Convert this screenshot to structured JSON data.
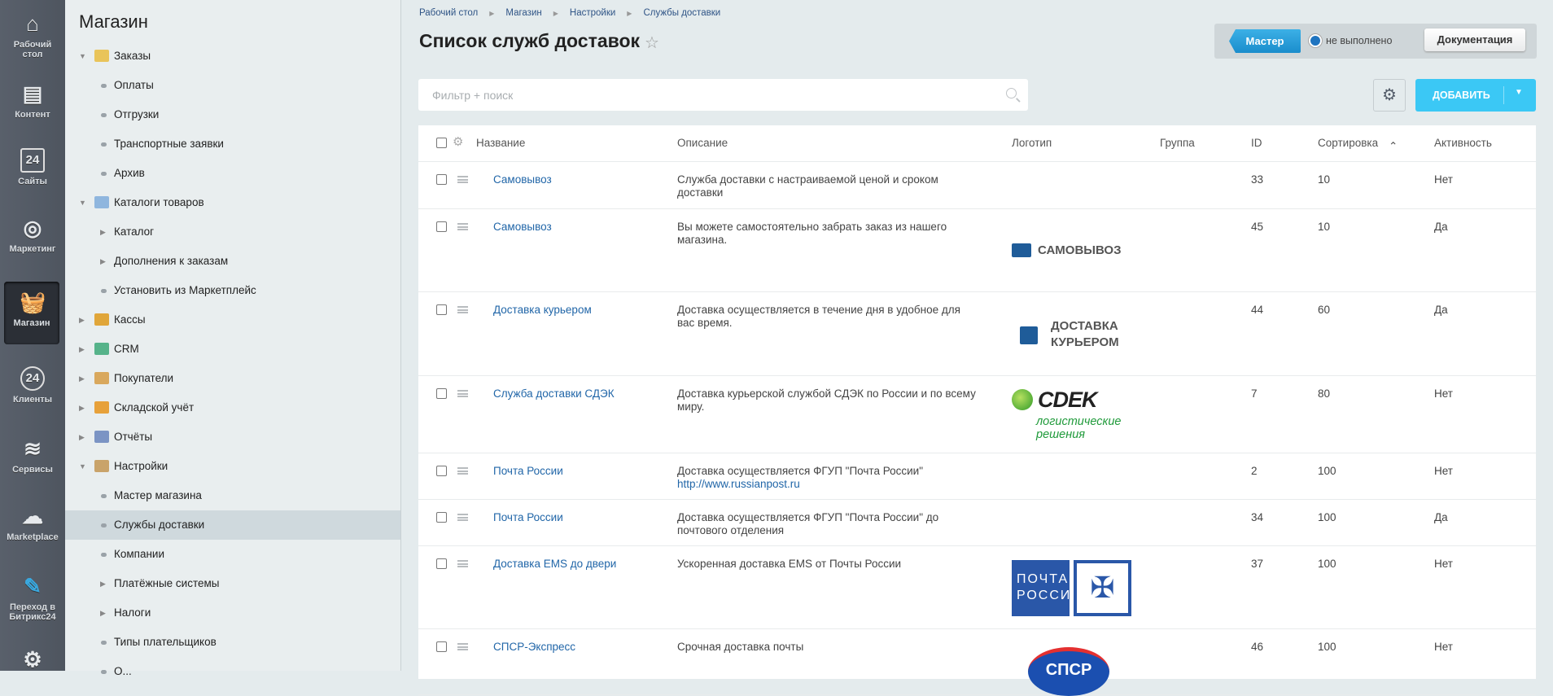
{
  "leftbar": [
    {
      "label": "Рабочий стол",
      "icon": "home-icon"
    },
    {
      "label": "Контент",
      "icon": "document-icon"
    },
    {
      "label": "Сайты",
      "icon": "sites-24-icon"
    },
    {
      "label": "Маркетинг",
      "icon": "target-icon"
    },
    {
      "label": "Магазин",
      "icon": "basket-icon",
      "active": true
    },
    {
      "label": "Клиенты",
      "icon": "clients-24-icon"
    },
    {
      "label": "Сервисы",
      "icon": "layers-icon"
    },
    {
      "label": "Marketplace",
      "icon": "cloud-download-icon"
    },
    {
      "label": "Переход в Битрикс24",
      "icon": "magic-edit-icon"
    },
    {
      "label": "",
      "icon": "gear-icon"
    }
  ],
  "tree": {
    "title": "Магазин",
    "items": [
      {
        "label": "Заказы",
        "level": 0,
        "expander": "open",
        "icon": "orders-icon"
      },
      {
        "label": "Оплаты",
        "level": 1,
        "expander": "dot"
      },
      {
        "label": "Отгрузки",
        "level": 1,
        "expander": "dot"
      },
      {
        "label": "Транспортные заявки",
        "level": 1,
        "expander": "dot"
      },
      {
        "label": "Архив",
        "level": 1,
        "expander": "dot"
      },
      {
        "label": "Каталоги товаров",
        "level": 0,
        "expander": "open",
        "icon": "folder-icon"
      },
      {
        "label": "Каталог",
        "level": 1,
        "expander": "closed"
      },
      {
        "label": "Дополнения к заказам",
        "level": 1,
        "expander": "closed"
      },
      {
        "label": "Установить из Маркетплейс",
        "level": 1,
        "expander": "dot"
      },
      {
        "label": "Кассы",
        "level": 0,
        "expander": "closed",
        "icon": "cashbox-icon"
      },
      {
        "label": "CRM",
        "level": 0,
        "expander": "closed",
        "icon": "crm-funnel-icon"
      },
      {
        "label": "Покупатели",
        "level": 0,
        "expander": "closed",
        "icon": "customers-icon"
      },
      {
        "label": "Складской учёт",
        "level": 0,
        "expander": "closed",
        "icon": "warehouse-icon"
      },
      {
        "label": "Отчёты",
        "level": 0,
        "expander": "closed",
        "icon": "reports-icon"
      },
      {
        "label": "Настройки",
        "level": 0,
        "expander": "open",
        "icon": "settings-icon"
      },
      {
        "label": "Мастер магазина",
        "level": 1,
        "expander": "dot"
      },
      {
        "label": "Службы доставки",
        "level": 1,
        "expander": "dot",
        "selected": true
      },
      {
        "label": "Компании",
        "level": 1,
        "expander": "dot"
      },
      {
        "label": "Платёжные системы",
        "level": 1,
        "expander": "closed"
      },
      {
        "label": "Налоги",
        "level": 1,
        "expander": "closed"
      },
      {
        "label": "Типы плательщиков",
        "level": 1,
        "expander": "dot"
      },
      {
        "label": "О...",
        "level": 1,
        "expander": "dot"
      }
    ]
  },
  "breadcrumb": [
    "Рабочий стол",
    "Магазин",
    "Настройки",
    "Службы доставки"
  ],
  "page_title": "Список служб доставок",
  "master": {
    "button": "Мастер",
    "status": "не выполнено",
    "docs": "Документация"
  },
  "filter": {
    "placeholder": "Фильтр + поиск",
    "value": ""
  },
  "add_button": "ДОБАВИТЬ",
  "table": {
    "columns": [
      "Название",
      "Описание",
      "Логотип",
      "Группа",
      "ID",
      "Сортировка",
      "Активность"
    ],
    "sorted_column": "Сортировка",
    "rows": [
      {
        "name": "Самовывоз",
        "desc": "Служба доставки с настраиваемой ценой и сроком доставки",
        "logo": "",
        "logo_text": "",
        "group": "",
        "id": "33",
        "sort": "10",
        "active": "Нет"
      },
      {
        "name": "Самовывоз",
        "desc": "Вы можете самостоятельно забрать заказ из нашего магазина.",
        "logo": "truck",
        "logo_text": "САМОВЫВОЗ",
        "group": "",
        "id": "45",
        "sort": "10",
        "active": "Да"
      },
      {
        "name": "Доставка курьером",
        "desc": "Доставка осуществляется в течение дня в удобное для вас время.",
        "logo": "box",
        "logo_text": "ДОСТАВКА КУРЬЕРОМ",
        "group": "",
        "id": "44",
        "sort": "60",
        "active": "Да"
      },
      {
        "name": "Служба доставки СДЭК",
        "desc": "Доставка курьерской службой СДЭК по России и по всему миру.",
        "logo": "cdek",
        "logo_text": "CDEK",
        "logo_sub": "логистические решения",
        "group": "",
        "id": "7",
        "sort": "80",
        "active": "Нет"
      },
      {
        "name": "Почта России",
        "desc": "Доставка осуществляется ФГУП \"Почта России\"",
        "desc_link": "http://www.russianpost.ru",
        "logo": "",
        "logo_text": "",
        "group": "",
        "id": "2",
        "sort": "100",
        "active": "Нет"
      },
      {
        "name": "Почта России",
        "desc": "Доставка осуществляется ФГУП \"Почта России\" до почтового отделения",
        "logo": "",
        "logo_text": "",
        "group": "",
        "id": "34",
        "sort": "100",
        "active": "Да"
      },
      {
        "name": "Доставка EMS до двери",
        "desc": "Ускоренная доставка EMS от Почты России",
        "logo": "pochta",
        "logo_text": "ПОЧТА РОССИИ",
        "group": "",
        "id": "37",
        "sort": "100",
        "active": "Нет"
      },
      {
        "name": "СПСР-Экспресс",
        "desc": "Срочная доставка почты",
        "logo": "spsr",
        "logo_text": "СПСР",
        "group": "",
        "id": "46",
        "sort": "100",
        "active": "Нет"
      }
    ]
  },
  "colors": {
    "accent": "#3bc8f5",
    "link": "#2166a8",
    "master": "#1a8dcc"
  }
}
